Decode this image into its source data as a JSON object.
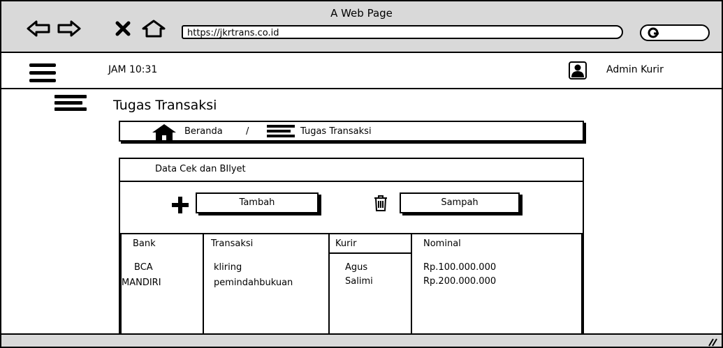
{
  "browser": {
    "title": "A Web Page",
    "url": "https://jkrtrans.co.id"
  },
  "header": {
    "clock": "JAM 10:31",
    "user_name": "Admin Kurir"
  },
  "page": {
    "heading": "Tugas Transaksi"
  },
  "breadcrumb": {
    "home": "Beranda",
    "separator": "/",
    "current": "Tugas Transaksi"
  },
  "card": {
    "title": "Data Cek dan BIlyet",
    "add_button": "Tambah",
    "trash_button": "Sampah"
  },
  "table": {
    "headers": [
      "Bank",
      "Transaksi",
      "Kurir",
      "Nominal"
    ],
    "bank": [
      "BCA",
      "MANDIRI"
    ],
    "transaksi": [
      "kliring",
      "pemindahbukuan"
    ],
    "kurir": [
      "Agus",
      "Salimi"
    ],
    "nominal": [
      "Rp.100.000.000",
      "Rp.200.000.000"
    ]
  },
  "colors": {
    "chrome": "#d9d9d9",
    "ink": "#000000",
    "background": "#ffffff"
  }
}
